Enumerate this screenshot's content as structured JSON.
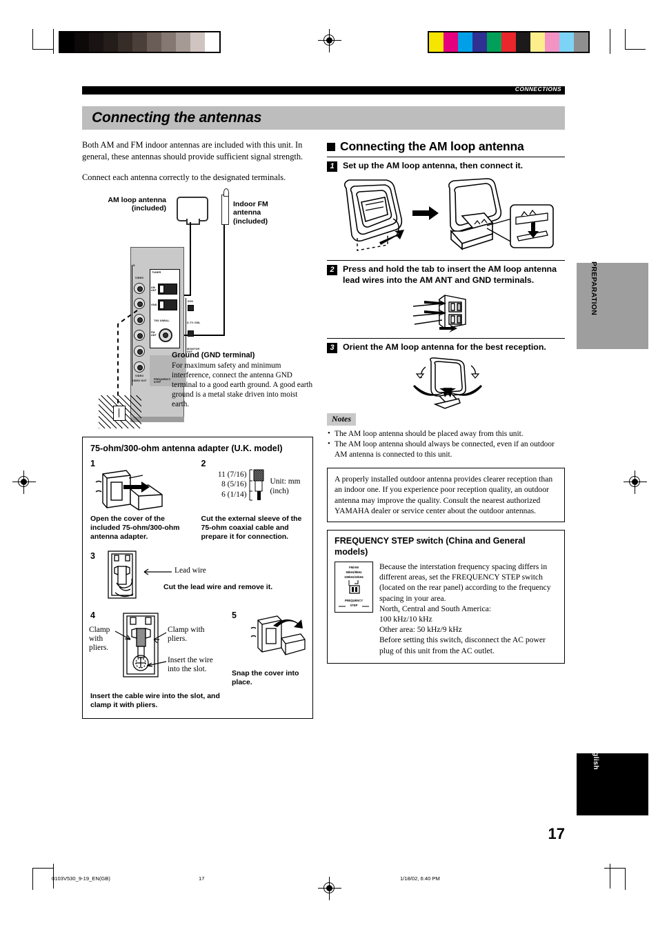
{
  "header": {
    "section_label": "CONNECTIONS"
  },
  "title": "Connecting the antennas",
  "intro": {
    "p1": "Both AM and FM indoor antennas are included with this unit. In general, these antennas should provide sufficient signal strength.",
    "p2": "Connect each antenna correctly to the designated terminals."
  },
  "diagram": {
    "am_loop_label": "AM loop antenna\n(included)",
    "am_loop_label_line1": "AM loop antenna",
    "am_loop_label_line2": "(included)",
    "fm_label_line1": "Indoor FM",
    "fm_label_line2": "antenna",
    "fm_label_line3": "(included)",
    "panel_labels": {
      "tuner": "TUNER",
      "am_ant": "AM ANT",
      "gnd": "GND",
      "unbal": "75Ω UNBAL.",
      "fm_ant": "FM ANT",
      "dvd": "DVD",
      "dtv_cbl": "D-TV /CBL",
      "monitor_out": "MONITOR OUT",
      "video": "VIDEO",
      "video_out": "VIDEO OUT",
      "freq_step": "FREQUENCY STEP",
      "d_mark": "D"
    },
    "ground_title": "Ground (GND terminal)",
    "ground_text": "For maximum safety and minimum interference, connect the antenna GND terminal to a good earth ground. A good earth ground is a metal stake driven into moist earth."
  },
  "adapter": {
    "heading": "75-ohm/300-ohm antenna adapter (U.K. model)",
    "step1_num": "1",
    "step1_caption": "Open the cover of the included 75-ohm/300-ohm antenna adapter.",
    "step2_num": "2",
    "step2_caption": "Cut the external sleeve of the 75-ohm coaxial cable and prepare it for connection.",
    "dim1": "11 (7/16)",
    "dim2": "8 (5/16)",
    "dim3": "6 (1/14)",
    "unit1": "Unit: mm",
    "unit2": "(inch)",
    "step3_num": "3",
    "step3_callout": "Lead wire",
    "step3_caption": "Cut the lead wire and remove it.",
    "step4_num": "4",
    "step4_callout_left": "Clamp with pliers.",
    "step4_callout_right": "Clamp with pliers.",
    "step4_callout_bottom": "Insert the wire into the slot.",
    "step4_caption": "Insert the cable wire into the slot, and clamp it with pliers.",
    "step5_num": "5",
    "step5_caption": "Snap the cover into place."
  },
  "am_section": {
    "heading": "Connecting the AM loop antenna",
    "step1_num": "1",
    "step1_text": "Set up the AM loop antenna, then connect it.",
    "step2_num": "2",
    "step2_text": "Press and hold the tab to insert the AM loop antenna lead wires into the AM ANT and GND terminals.",
    "step3_num": "3",
    "step3_text": "Orient the AM loop antenna for the best reception."
  },
  "notes": {
    "label": "Notes",
    "items": [
      "The AM loop antenna should be placed away from this unit.",
      "The AM loop antenna should always be connected, even if an outdoor AM antenna is connected to this unit."
    ]
  },
  "tip_box": {
    "text": "A properly installed outdoor antenna provides clearer reception than an indoor one. If you experience poor reception quality, an outdoor antenna may improve the quality. Consult the nearest authorized YAMAHA dealer or service center about the outdoor antennas."
  },
  "freq_box": {
    "heading": "FREQUENCY STEP switch (China and General models)",
    "switch_line1": "FM/AM",
    "switch_line2": "50kHz/9kHz",
    "switch_line3": "100kHz/10kHz",
    "switch_line4": "FREQUENCY",
    "switch_line5": "STEP",
    "text": "Because the interstation frequency spacing differs in different areas, set the FREQUENCY STEP switch (located on the rear panel) according to the frequency spacing in your area.\nNorth, Central and South America:\n100 kHz/10 kHz\nOther area: 50 kHz/9 kHz\nBefore setting this switch, disconnect the AC power plug of this unit from the AC outlet."
  },
  "side_tabs": {
    "preparation": "PREPARATION",
    "english": "English"
  },
  "page_number": "17",
  "footer": {
    "file": "0103V530_9-19_EN(GB)",
    "page": "17",
    "timestamp": "1/18/02, 6:40 PM"
  },
  "print_marks": {
    "gray_swatches": [
      "#000000",
      "#0d0909",
      "#191313",
      "#241d1a",
      "#362c28",
      "#4b3f3a",
      "#6a5c56",
      "#857873",
      "#a69a95",
      "#cfc4c0",
      "#ffffff"
    ],
    "color_swatches": [
      "#f5e500",
      "#e5007e",
      "#00a0e9",
      "#2e3192",
      "#00a05a",
      "#e8262b",
      "#1c1a1a",
      "#fbee8b",
      "#f293c4",
      "#7dd3f5",
      "#8e8e8e"
    ]
  }
}
